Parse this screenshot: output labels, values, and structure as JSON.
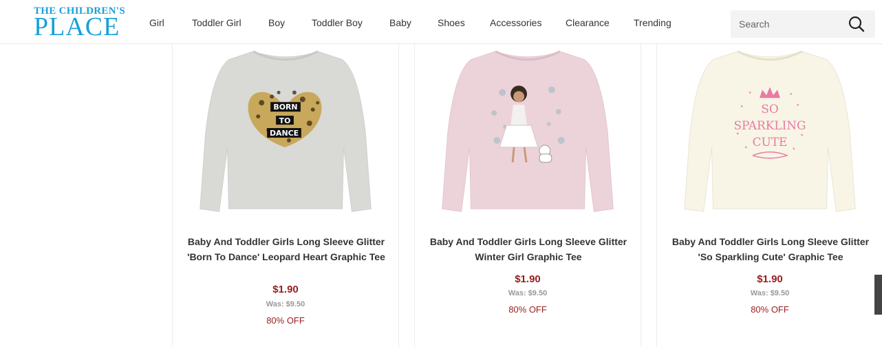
{
  "header": {
    "logo_line1": "THE CHILDREN'S",
    "logo_line2": "PLACE",
    "nav": [
      "Girl",
      "Toddler Girl",
      "Boy",
      "Toddler Boy",
      "Baby",
      "Shoes",
      "Accessories",
      "Clearance",
      "Trending"
    ],
    "search_placeholder": "Search"
  },
  "colors": {
    "brand": "#19a0d8",
    "price": "#9b1c1c",
    "was_price": "#999999"
  },
  "products": [
    {
      "name": "Baby And Toddler Girls Long Sleeve Glitter 'Born To Dance' Leopard Heart Graphic Tee",
      "price": "$1.90",
      "was": "Was: $9.50",
      "discount": "80% OFF",
      "graphic_text": [
        "BORN",
        "TO",
        "DANCE"
      ]
    },
    {
      "name": "Baby And Toddler Girls Long Sleeve Glitter Winter Girl Graphic Tee",
      "price": "$1.90",
      "was": "Was: $9.50",
      "discount": "80% OFF"
    },
    {
      "name": "Baby And Toddler Girls Long Sleeve Glitter 'So Sparkling Cute' Graphic Tee",
      "price": "$1.90",
      "was": "Was: $9.50",
      "discount": "80% OFF",
      "graphic_text": [
        "SO",
        "SPARKLING",
        "CUTE"
      ]
    }
  ]
}
